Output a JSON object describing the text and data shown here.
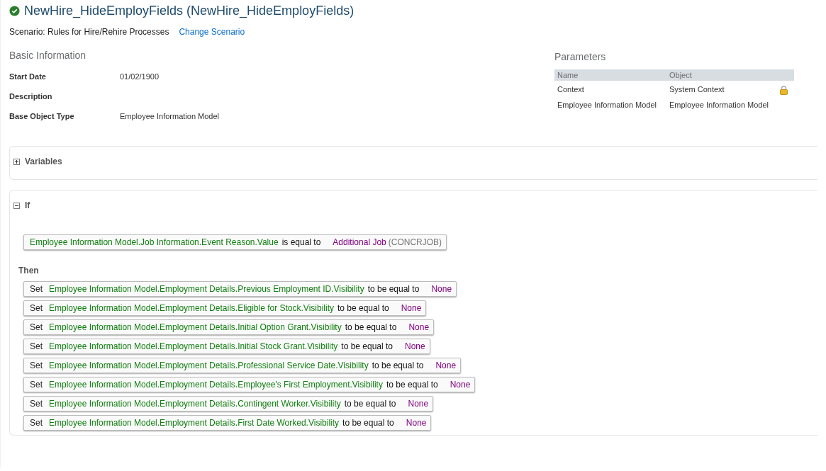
{
  "title": "NewHire_HideEmployFields (NewHire_HideEmployFields)",
  "scenario": {
    "text": "Scenario: Rules for Hire/Rehire Processes",
    "link": "Change Scenario"
  },
  "basic_information": {
    "heading": "Basic Information",
    "fields": [
      {
        "label": "Start Date",
        "value": "01/02/1900"
      },
      {
        "label": "Description"
      },
      {
        "label": "Base Object Type",
        "value": "Employee Information Model"
      }
    ]
  },
  "parameters": {
    "heading": "Parameters",
    "columns": [
      "Name",
      "Object"
    ],
    "rows": [
      {
        "name": "Context",
        "object": "System Context",
        "locked": true
      },
      {
        "name": "Employee Information Model",
        "object": "Employee Information Model",
        "locked": false
      }
    ]
  },
  "variables": {
    "label": "Variables",
    "expanded": false
  },
  "if": {
    "label": "If",
    "expanded": true,
    "condition": {
      "field": "Employee Information Model.Job Information.Event Reason.Value",
      "operator": "is equal to",
      "value": "Additional Job",
      "code": "(CONCRJOB)"
    },
    "then_label": "Then",
    "actions": [
      {
        "keyword": "Set",
        "field": "Employee Information Model.Employment Details.Previous Employment ID.Visibility",
        "operator": "to be equal to",
        "value": "None"
      },
      {
        "keyword": "Set",
        "field": "Employee Information Model.Employment Details.Eligible for Stock.Visibility",
        "operator": "to be equal to",
        "value": "None"
      },
      {
        "keyword": "Set",
        "field": "Employee Information Model.Employment Details.Initial Option Grant.Visibility",
        "operator": "to be equal to",
        "value": "None"
      },
      {
        "keyword": "Set",
        "field": "Employee Information Model.Employment Details.Initial Stock Grant.Visibility",
        "operator": "to be equal to",
        "value": "None"
      },
      {
        "keyword": "Set",
        "field": "Employee Information Model.Employment Details.Professional Service Date.Visibility",
        "operator": "to be equal to",
        "value": "None"
      },
      {
        "keyword": "Set",
        "field": "Employee Information Model.Employment Details.Employee's First Employment.Visibility",
        "operator": "to be equal to",
        "value": "None"
      },
      {
        "keyword": "Set",
        "field": "Employee Information Model.Employment Details.Contingent Worker.Visibility",
        "operator": "to be equal to",
        "value": "None"
      },
      {
        "keyword": "Set",
        "field": "Employee Information Model.Employment Details.First Date Worked.Visibility",
        "operator": "to be equal to",
        "value": "None"
      }
    ]
  }
}
